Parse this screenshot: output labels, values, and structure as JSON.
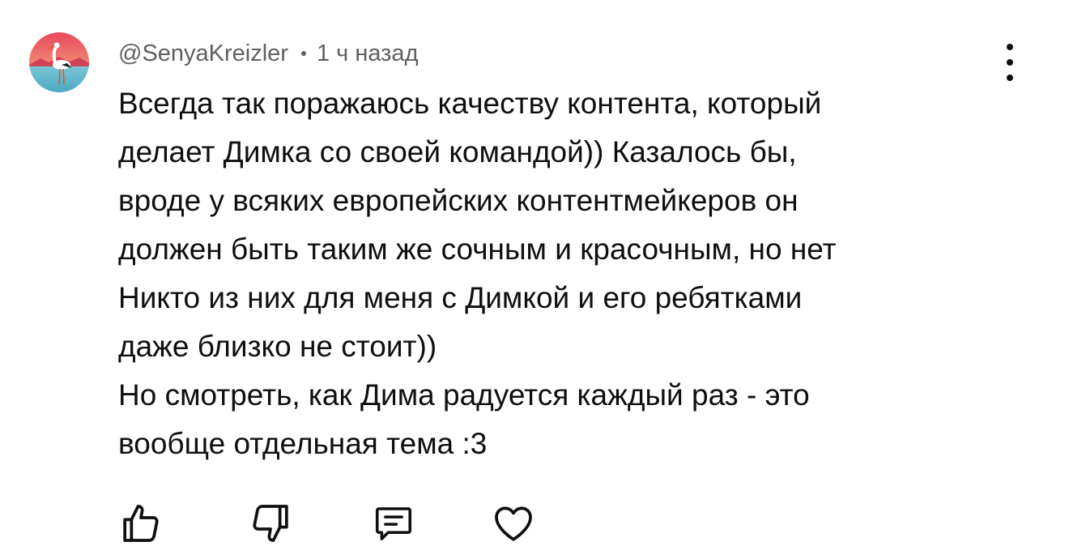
{
  "comment": {
    "author": "@SenyaKreizler",
    "timestamp": "1 ч назад",
    "avatar_icon": "stork-avatar-icon",
    "more_icon": "more-vertical-icon",
    "lines": [
      "Всегда так поражаюсь качеству контента, который",
      "делает Димка со своей командой)) Казалось бы,",
      "вроде у всяких европейских контентмейкеров он",
      "должен быть таким же сочным и красочным, но нет",
      "Никто из них для меня с Димкой и его ребятками",
      "даже близко не стоит))",
      "Но смотреть, как Дима радуется каждый раз - это",
      "вообще отдельная тема :3"
    ]
  },
  "actions": {
    "like_icon": "thumbs-up-icon",
    "dislike_icon": "thumbs-down-icon",
    "reply_icon": "reply-comment-icon",
    "heart_icon": "heart-icon"
  },
  "colors": {
    "text": "#0f0f0f",
    "secondary_text": "#606060",
    "background": "#ffffff"
  }
}
